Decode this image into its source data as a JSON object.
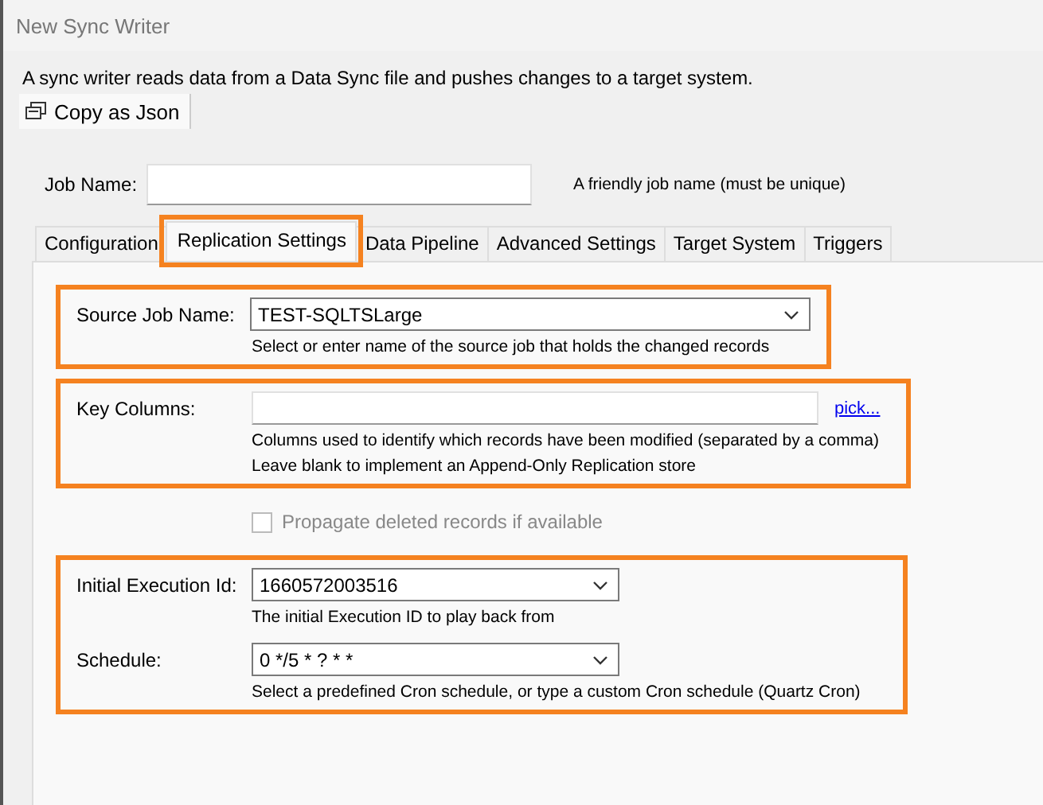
{
  "window": {
    "title": "New Sync Writer"
  },
  "description": "A sync writer reads data from a Data Sync file and pushes changes to a target system.",
  "toolbar": {
    "copy_button": "Copy as Json"
  },
  "job_name": {
    "label": "Job Name:",
    "hint": "A friendly job name (must be unique)"
  },
  "tabs": [
    {
      "label": "Configuration",
      "selected": false,
      "highlighted": false
    },
    {
      "label": "Replication Settings",
      "selected": true,
      "highlighted": true
    },
    {
      "label": "Data Pipeline",
      "selected": false,
      "highlighted": false
    },
    {
      "label": "Advanced Settings",
      "selected": false,
      "highlighted": false
    },
    {
      "label": "Target System",
      "selected": false,
      "highlighted": false
    },
    {
      "label": "Triggers",
      "selected": false,
      "highlighted": false
    }
  ],
  "groups": [
    {
      "highlighted": true,
      "fields": [
        {
          "kind": "combo",
          "label": "Source Job Name:",
          "value": "TEST-SQLTSLarge",
          "hints": [
            "Select or enter name of the source job that holds the changed records"
          ]
        }
      ]
    },
    {
      "highlighted": true,
      "fields": [
        {
          "kind": "text",
          "label": "Key Columns:",
          "link": "pick...",
          "hints": [
            "Columns used to identify which records have been modified (separated by a comma)",
            "Leave blank to implement an Append-Only Replication store"
          ]
        }
      ]
    },
    {
      "highlighted": false,
      "fields": [
        {
          "kind": "checkbox",
          "label": "Propagate deleted records if available",
          "checked": false,
          "disabled": true
        }
      ]
    },
    {
      "highlighted": true,
      "fields": [
        {
          "kind": "combo",
          "label": "Initial Execution Id:",
          "value": "1660572003516",
          "hints": [
            "The initial Execution ID to play back from"
          ]
        },
        {
          "kind": "combo",
          "label": "Schedule:",
          "value": "0 */5 * ? * *",
          "hints": [
            "Select a predefined Cron schedule, or type a custom Cron schedule (Quartz Cron)"
          ]
        }
      ]
    }
  ]
}
